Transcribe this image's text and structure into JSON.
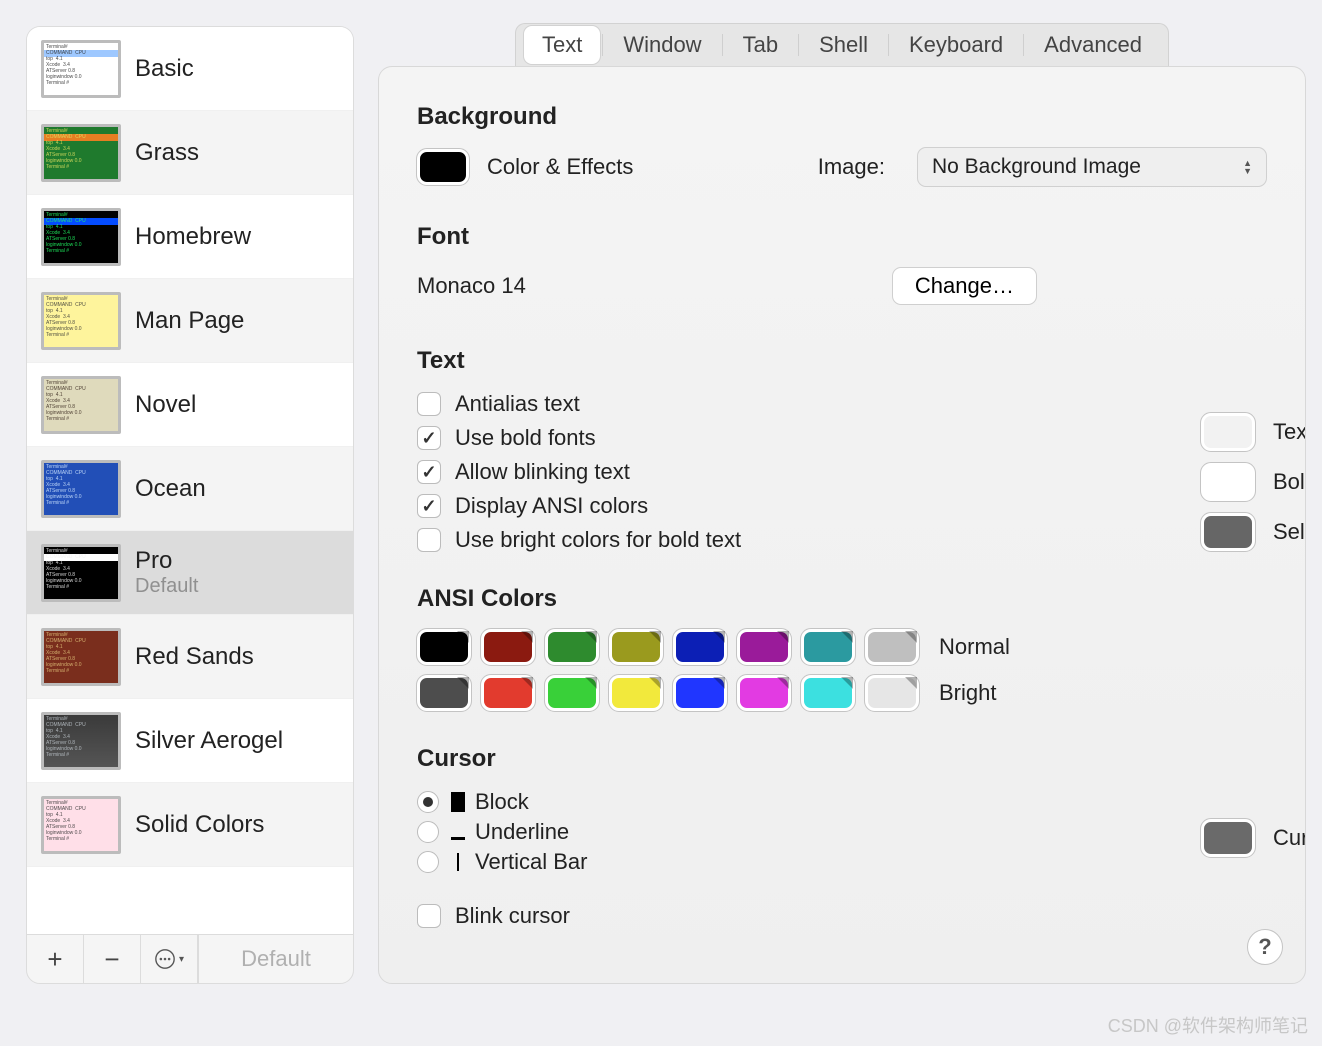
{
  "sidebar": {
    "profiles": [
      {
        "id": "basic",
        "name": "Basic",
        "thumb": "thumb-basic"
      },
      {
        "id": "grass",
        "name": "Grass",
        "thumb": "thumb-grass"
      },
      {
        "id": "homebrew",
        "name": "Homebrew",
        "thumb": "thumb-homebrew"
      },
      {
        "id": "manpage",
        "name": "Man Page",
        "thumb": "thumb-manpage"
      },
      {
        "id": "novel",
        "name": "Novel",
        "thumb": "thumb-novel"
      },
      {
        "id": "ocean",
        "name": "Ocean",
        "thumb": "thumb-ocean"
      },
      {
        "id": "pro",
        "name": "Pro",
        "sub": "Default",
        "thumb": "thumb-pro",
        "selected": true
      },
      {
        "id": "redsands",
        "name": "Red Sands",
        "thumb": "thumb-redsands"
      },
      {
        "id": "silver",
        "name": "Silver Aerogel",
        "thumb": "thumb-silver"
      },
      {
        "id": "solid",
        "name": "Solid Colors",
        "thumb": "thumb-solid"
      }
    ],
    "footer": {
      "add_label": "+",
      "remove_label": "−",
      "default_label": "Default"
    }
  },
  "tabs": {
    "items": [
      "Text",
      "Window",
      "Tab",
      "Shell",
      "Keyboard",
      "Advanced"
    ],
    "active": "Text"
  },
  "background": {
    "heading": "Background",
    "well_label": "Color & Effects",
    "well_color": "#000000",
    "image_label": "Image:",
    "image_popup_value": "No Background Image"
  },
  "font": {
    "heading": "Font",
    "value": "Monaco 14",
    "change_label": "Change…"
  },
  "text": {
    "heading": "Text",
    "options": [
      {
        "label": "Antialias text",
        "checked": false
      },
      {
        "label": "Use bold fonts",
        "checked": true
      },
      {
        "label": "Allow blinking text",
        "checked": true
      },
      {
        "label": "Display ANSI colors",
        "checked": true
      },
      {
        "label": "Use bright colors for bold text",
        "checked": false
      }
    ],
    "wells": [
      {
        "label": "Text",
        "color": "#f2f2f2",
        "editable": false
      },
      {
        "label": "Bold Text",
        "color": "#ffffff",
        "editable": false
      },
      {
        "label": "Selection",
        "color": "#666666",
        "editable": false
      }
    ]
  },
  "ansi": {
    "heading": "ANSI Colors",
    "normal_label": "Normal",
    "bright_label": "Bright",
    "normal": [
      "#000000",
      "#8b1a10",
      "#2e8b2e",
      "#9a9a1e",
      "#0c1fb5",
      "#9a1b9a",
      "#2b9aa0",
      "#bfbfbf"
    ],
    "bright": [
      "#4d4d4d",
      "#e23b2e",
      "#39d039",
      "#f2e93c",
      "#2036ff",
      "#e23be2",
      "#3ce0e0",
      "#e6e6e6"
    ]
  },
  "cursor": {
    "heading": "Cursor",
    "options": [
      {
        "label": "Block",
        "shape": "block",
        "checked": true
      },
      {
        "label": "Underline",
        "shape": "underline",
        "checked": false
      },
      {
        "label": "Vertical Bar",
        "shape": "bar",
        "checked": false
      }
    ],
    "blink_label": "Blink cursor",
    "blink_checked": false,
    "well_label": "Cursor",
    "well_color": "#6a6a6a"
  },
  "help_label": "?",
  "watermark": "CSDN @软件架构师笔记"
}
